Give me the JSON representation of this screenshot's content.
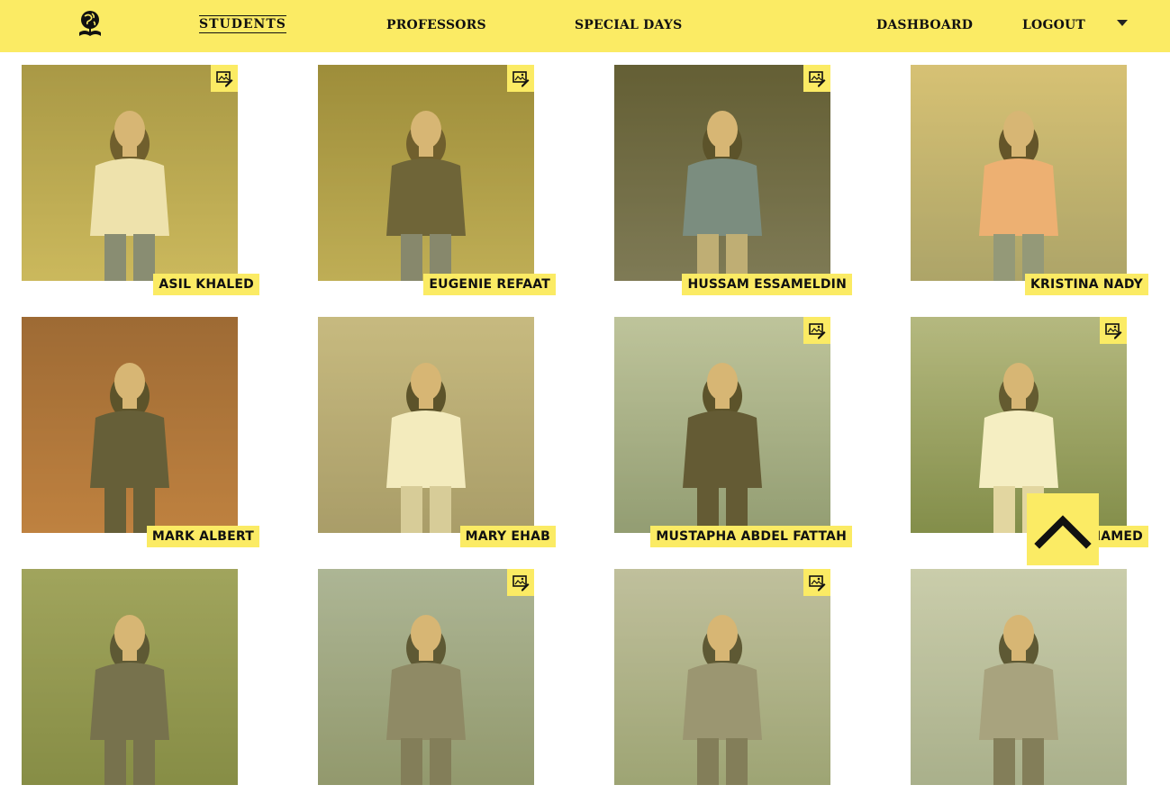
{
  "nav": {
    "links": [
      "STUDENTS",
      "PROFESSORS",
      "SPECIAL DAYS",
      "DASHBOARD",
      "LOGOUT"
    ],
    "active": "STUDENTS"
  },
  "colors": {
    "accent": "#fbeb64",
    "text": "#111111"
  },
  "icons": {
    "logo": "globe-book-icon",
    "edit": "edit-photo-icon",
    "menu": "caret-down-icon",
    "scroll": "chevron-up-icon"
  },
  "students": [
    {
      "name": "ASIL KHALED",
      "editable": true
    },
    {
      "name": "EUGENIE REFAAT",
      "editable": true
    },
    {
      "name": "HUSSAM ESSAMELDIN",
      "editable": true
    },
    {
      "name": "KRISTINA NADY",
      "editable": false
    },
    {
      "name": "MARK ALBERT",
      "editable": false
    },
    {
      "name": "MARY EHAB",
      "editable": false
    },
    {
      "name": "MUSTAPHA ABDEL FATTAH",
      "editable": true
    },
    {
      "name": "HAMED",
      "editable": true
    },
    {
      "name": "",
      "editable": false
    },
    {
      "name": "",
      "editable": true
    },
    {
      "name": "",
      "editable": true
    },
    {
      "name": "",
      "editable": false
    }
  ]
}
